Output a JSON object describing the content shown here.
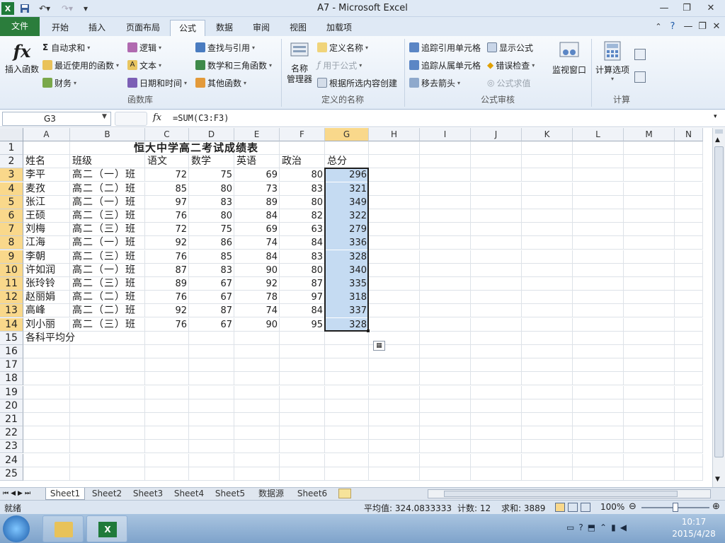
{
  "window": {
    "title": "A7 - Microsoft Excel"
  },
  "quick_access": {
    "save_icon": "save-icon",
    "undo_icon": "undo-icon",
    "redo_icon": "redo-icon"
  },
  "tabs": [
    "文件",
    "开始",
    "插入",
    "页面布局",
    "公式",
    "数据",
    "审阅",
    "视图",
    "加载项"
  ],
  "active_tab": "公式",
  "ribbon": {
    "insert_function": "插入函数",
    "autosum": "自动求和",
    "recent": "最近使用的函数",
    "financial": "财务",
    "logical": "逻辑",
    "text": "文本",
    "datetime": "日期和时间",
    "lookup": "查找与引用",
    "math": "数学和三角函数",
    "other": "其他函数",
    "group_library": "函数库",
    "name_manager_line1": "名称",
    "name_manager_line2": "管理器",
    "define_name": "定义名称",
    "use_in_formula": "用于公式",
    "create_from_selection": "根据所选内容创建",
    "group_names": "定义的名称",
    "trace_precedents": "追踪引用单元格",
    "trace_dependents": "追踪从属单元格",
    "remove_arrows": "移去箭头",
    "show_formulas": "显示公式",
    "error_checking": "错误检查",
    "evaluate_formula": "公式求值",
    "group_audit": "公式审核",
    "watch_window": "监视窗口",
    "calc_options": "计算选项",
    "group_calc": "计算"
  },
  "formula_bar": {
    "name_box": "G3",
    "fx": "fx",
    "formula": "=SUM(C3:F3)"
  },
  "columns": [
    "A",
    "B",
    "C",
    "D",
    "E",
    "F",
    "G",
    "H",
    "I",
    "J",
    "K",
    "L",
    "M",
    "N"
  ],
  "rows": [
    "1",
    "2",
    "3",
    "4",
    "5",
    "6",
    "7",
    "8",
    "9",
    "10",
    "11",
    "12",
    "13",
    "14",
    "15",
    "16",
    "17",
    "18",
    "19",
    "20",
    "21",
    "22",
    "23",
    "24",
    "25"
  ],
  "sheet": {
    "title": "恒大中学高二考试成绩表",
    "headers": [
      "姓名",
      "班级",
      "语文",
      "数学",
      "英语",
      "政治",
      "总分"
    ],
    "records": [
      [
        "李平",
        "高二（一）班",
        "72",
        "75",
        "69",
        "80",
        "296"
      ],
      [
        "麦孜",
        "高二（二）班",
        "85",
        "80",
        "73",
        "83",
        "321"
      ],
      [
        "张江",
        "高二（一）班",
        "97",
        "83",
        "89",
        "80",
        "349"
      ],
      [
        "王硕",
        "高二（三）班",
        "76",
        "80",
        "84",
        "82",
        "322"
      ],
      [
        "刘梅",
        "高二（三）班",
        "72",
        "75",
        "69",
        "63",
        "279"
      ],
      [
        "江海",
        "高二（一）班",
        "92",
        "86",
        "74",
        "84",
        "336"
      ],
      [
        "李朝",
        "高二（三）班",
        "76",
        "85",
        "84",
        "83",
        "328"
      ],
      [
        "许如润",
        "高二（一）班",
        "87",
        "83",
        "90",
        "80",
        "340"
      ],
      [
        "张玲铃",
        "高二（三）班",
        "89",
        "67",
        "92",
        "87",
        "335"
      ],
      [
        "赵丽娟",
        "高二（二）班",
        "76",
        "67",
        "78",
        "97",
        "318"
      ],
      [
        "高峰",
        "高二（二）班",
        "92",
        "87",
        "74",
        "84",
        "337"
      ],
      [
        "刘小丽",
        "高二（三）班",
        "76",
        "67",
        "90",
        "95",
        "328"
      ]
    ],
    "footer": "各科平均分"
  },
  "sheet_tabs": [
    "Sheet1",
    "Sheet2",
    "Sheet3",
    "Sheet4",
    "Sheet5",
    "数据源",
    "Sheet6"
  ],
  "active_sheet": "Sheet1",
  "status": {
    "ready": "就绪",
    "average": "平均值: 324.0833333",
    "count": "计数: 12",
    "sum": "求和: 3889",
    "zoom": "100%"
  },
  "taskbar": {
    "time": "10:17",
    "date": "2015/4/28"
  },
  "colors": {
    "accent": "#2b7d3c",
    "selection": "#c5dbf2",
    "header_highlight": "#f9d88b"
  }
}
